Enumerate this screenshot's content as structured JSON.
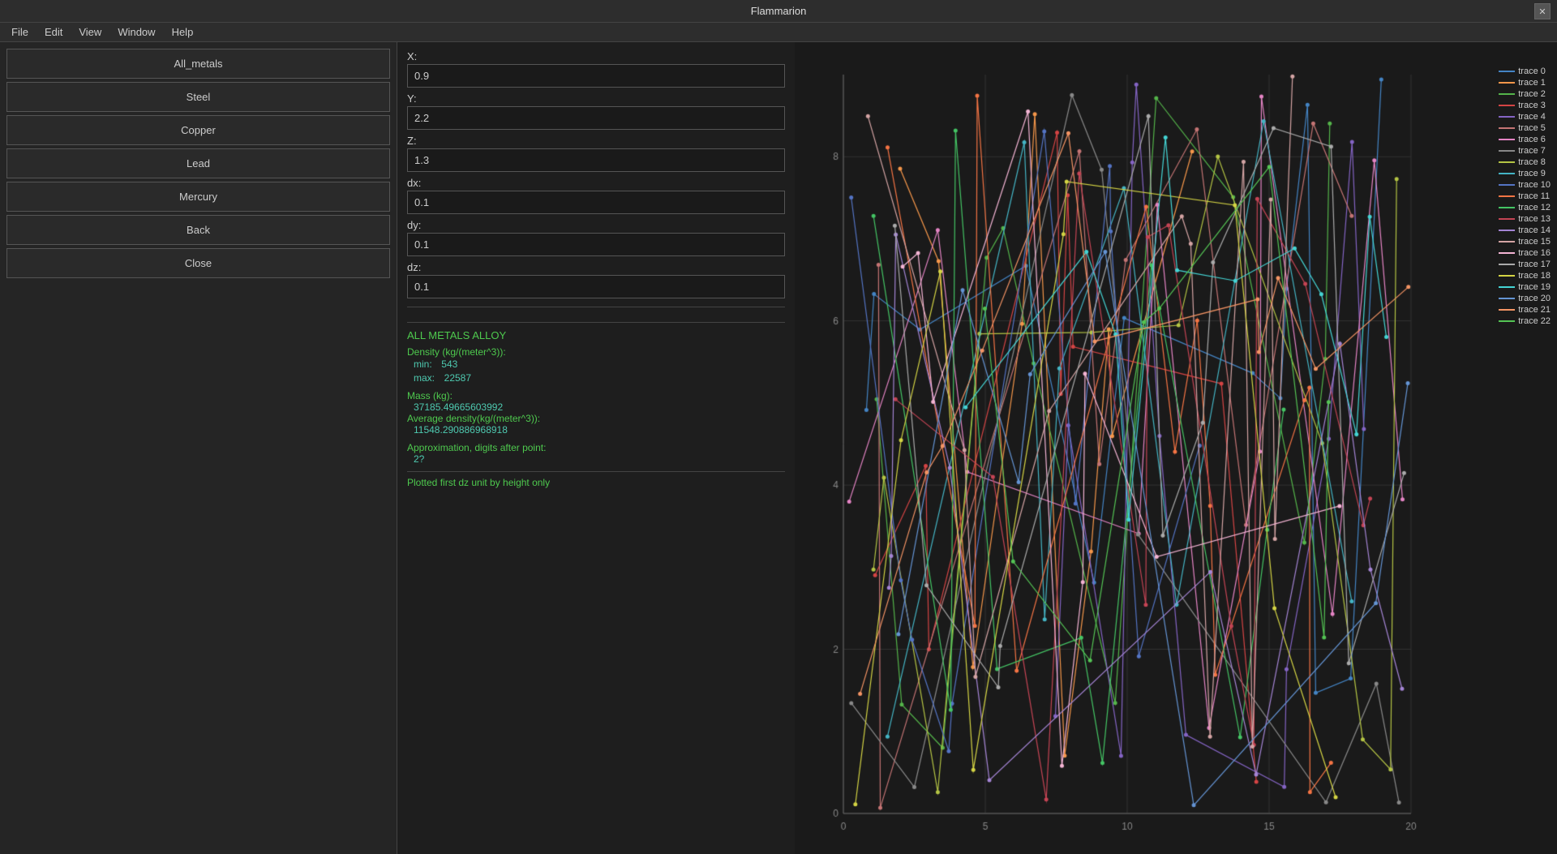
{
  "window": {
    "title": "Flammarion"
  },
  "menubar": {
    "items": [
      "File",
      "Edit",
      "View",
      "Window",
      "Help"
    ]
  },
  "left_panel": {
    "buttons": [
      {
        "label": "All_metals",
        "id": "all-metals"
      },
      {
        "label": "Steel",
        "id": "steel"
      },
      {
        "label": "Copper",
        "id": "copper"
      },
      {
        "label": "Lead",
        "id": "lead"
      },
      {
        "label": "Mercury",
        "id": "mercury"
      },
      {
        "label": "Back",
        "id": "back"
      },
      {
        "label": "Close",
        "id": "close"
      }
    ]
  },
  "fields": {
    "x": {
      "label": "X:",
      "value": "0.9"
    },
    "y": {
      "label": "Y:",
      "value": "2.2"
    },
    "z": {
      "label": "Z:",
      "value": "1.3"
    },
    "dx": {
      "label": "dx:",
      "value": "0.1"
    },
    "dy": {
      "label": "dy:",
      "value": "0.1"
    },
    "dz": {
      "label": "dz:",
      "value": "0.1"
    }
  },
  "info": {
    "title": "ALL METALS ALLOY",
    "density_label": "Density (kg/(meter^3)):",
    "density_min_label": "min:",
    "density_min_value": "543",
    "density_max_label": "max:",
    "density_max_value": "22587",
    "mass_label": "Mass (kg):",
    "mass_value": "37185.49665603992",
    "avg_density_label": "Average density(kg/(meter^3)):",
    "avg_density_value": "11548.290886968918",
    "approx_label": "Approximation, digits after point:",
    "approx_value": "2?",
    "plotted_note": "Plotted first dz unit by height only"
  },
  "legend": {
    "traces": [
      {
        "label": "trace 0",
        "color": "#4484c4"
      },
      {
        "label": "trace 1",
        "color": "#f4964a"
      },
      {
        "label": "trace 2",
        "color": "#54b44a"
      },
      {
        "label": "trace 3",
        "color": "#d44444"
      },
      {
        "label": "trace 4",
        "color": "#8464c4"
      },
      {
        "label": "trace 5",
        "color": "#c47474"
      },
      {
        "label": "trace 6",
        "color": "#e484c4"
      },
      {
        "label": "trace 7",
        "color": "#888888"
      },
      {
        "label": "trace 8",
        "color": "#b4c444"
      },
      {
        "label": "trace 9",
        "color": "#44b4c4"
      },
      {
        "label": "trace 10",
        "color": "#5474c4"
      },
      {
        "label": "trace 11",
        "color": "#f47444"
      },
      {
        "label": "trace 12",
        "color": "#44c464"
      },
      {
        "label": "trace 13",
        "color": "#c44454"
      },
      {
        "label": "trace 14",
        "color": "#a484d4"
      },
      {
        "label": "trace 15",
        "color": "#d4a4a4"
      },
      {
        "label": "trace 16",
        "color": "#f4b4d4"
      },
      {
        "label": "trace 17",
        "color": "#aaaaaa"
      },
      {
        "label": "trace 18",
        "color": "#d4d444"
      },
      {
        "label": "trace 19",
        "color": "#44d4d4"
      },
      {
        "label": "trace 20",
        "color": "#6494d4"
      },
      {
        "label": "trace 21",
        "color": "#f49464"
      },
      {
        "label": "trace 22",
        "color": "#54c454"
      }
    ]
  }
}
